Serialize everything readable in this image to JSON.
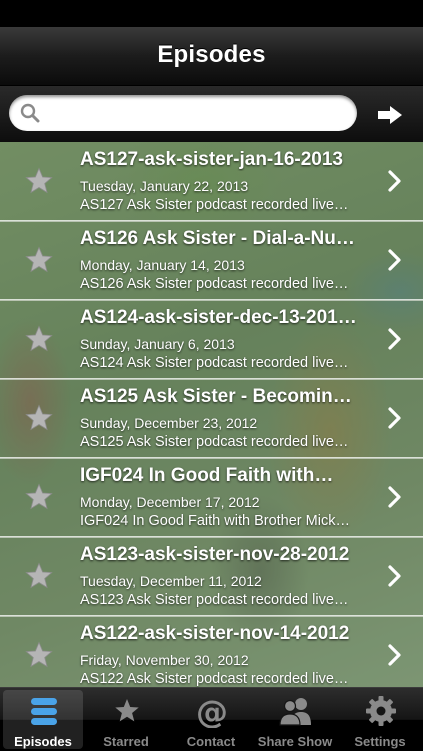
{
  "nav": {
    "title": "Episodes"
  },
  "search": {
    "placeholder": "",
    "value": ""
  },
  "episodes": [
    {
      "title": "AS127-ask-sister-jan-16-2013",
      "date": "Tuesday, January 22, 2013",
      "description": "AS127 Ask Sister podcast recorded live…"
    },
    {
      "title": "AS126 Ask Sister - Dial-a-Nu…",
      "date": "Monday, January 14, 2013",
      "description": "AS126 Ask Sister podcast recorded live…"
    },
    {
      "title": "AS124-ask-sister-dec-13-201…",
      "date": "Sunday, January 6, 2013",
      "description": "AS124 Ask Sister podcast recorded live…"
    },
    {
      "title": "AS125 Ask Sister - Becomin…",
      "date": "Sunday, December 23, 2012",
      "description": "AS125 Ask Sister podcast recorded live…"
    },
    {
      "title": "IGF024 In Good Faith with…",
      "date": "Monday, December 17, 2012",
      "description": "IGF024 In Good Faith with Brother Mick…"
    },
    {
      "title": "AS123-ask-sister-nov-28-2012",
      "date": "Tuesday, December 11, 2012",
      "description": "AS123 Ask Sister podcast recorded live…"
    },
    {
      "title": "AS122-ask-sister-nov-14-2012",
      "date": "Friday, November 30, 2012",
      "description": "AS122 Ask Sister podcast recorded live…"
    }
  ],
  "tabs": [
    {
      "label": "Episodes",
      "icon": "episodes-icon",
      "selected": true
    },
    {
      "label": "Starred",
      "icon": "star-icon",
      "selected": false
    },
    {
      "label": "Contact",
      "icon": "at-sign-icon",
      "selected": false
    },
    {
      "label": "Share Show",
      "icon": "people-icon",
      "selected": false
    },
    {
      "label": "Settings",
      "icon": "gear-icon",
      "selected": false
    }
  ],
  "colors": {
    "accent_blue": "#4aa3e8",
    "star_gray": "#b5b5b5"
  }
}
